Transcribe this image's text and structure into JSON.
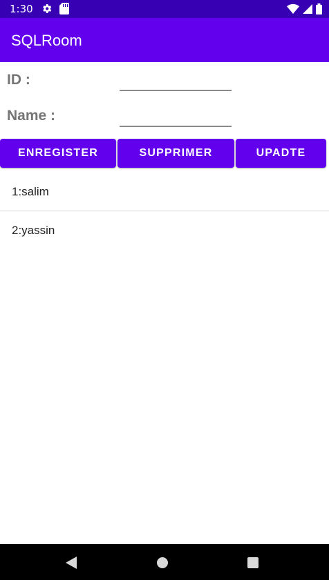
{
  "status_bar": {
    "time": "1:30",
    "icons": [
      "gear-icon",
      "sd-card-icon",
      "wifi-icon",
      "signal-icon",
      "battery-icon"
    ]
  },
  "app_bar": {
    "title": "SQLRoom"
  },
  "form": {
    "id_label": "ID :",
    "id_value": "",
    "name_label": "Name :",
    "name_value": ""
  },
  "buttons": {
    "save": "ENREGISTER",
    "delete": "SUPPRIMER",
    "update": "UPADTE"
  },
  "list": {
    "items": [
      "1:salim",
      "2:yassin"
    ]
  },
  "nav_bar": {
    "icons": [
      "back-icon",
      "home-icon",
      "recents-icon"
    ]
  },
  "colors": {
    "status_bar": "#3700b3",
    "primary": "#6200ee",
    "label_text": "#757575"
  }
}
